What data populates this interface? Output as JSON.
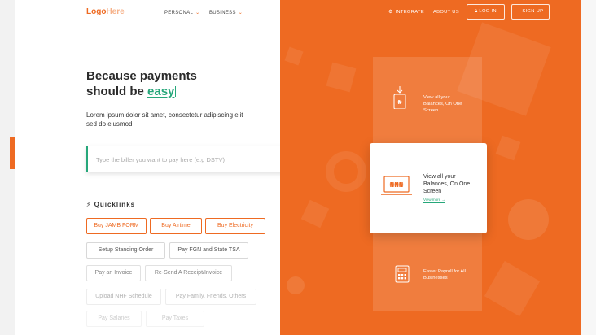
{
  "brand": {
    "logo_main": "Logo",
    "logo_light": "Here"
  },
  "nav": {
    "personal": "PERSONAL",
    "business": "BUSINESS",
    "integrate": "INTEGRATE",
    "about": "ABOUT US",
    "login": "LOG IN",
    "signup": "SIGN UP"
  },
  "hero": {
    "headline_line1": "Because payments",
    "headline_line2_prefix": "should be",
    "headline_highlight": "easy",
    "subtext": "Lorem ipsum dolor sit amet, consectetur adipiscing elit sed do eiusmod"
  },
  "search": {
    "placeholder": "Type the biller you want to pay here (e.g DSTV)",
    "icon": "search-icon"
  },
  "quicklinks": {
    "title": "Quicklinks",
    "primary": [
      "Buy JAMB FORM",
      "Buy Airtime",
      "Buy Electricity"
    ],
    "secondary": [
      "Setup Standing Order",
      "Pay FGN and State TSA",
      "Pay an Invoice",
      "Re-Send A Receipt/Invoice",
      "Upload NHF Schedule",
      "Pay Family, Friends, Others",
      "Pay Salaries",
      "Pay Taxes"
    ]
  },
  "features": {
    "top": {
      "text": "View all your Balances, On One Screen",
      "icon": "mobile-naira-icon"
    },
    "active": {
      "text": "View all your Balances, On One Screen",
      "link": "View more →",
      "icon": "laptop-naira-icon"
    },
    "bottom": {
      "text": "Easier Payroll for All Businesses",
      "icon": "calculator-icon"
    }
  },
  "colors": {
    "accent": "#ee6a22",
    "highlight": "#26a77a"
  }
}
